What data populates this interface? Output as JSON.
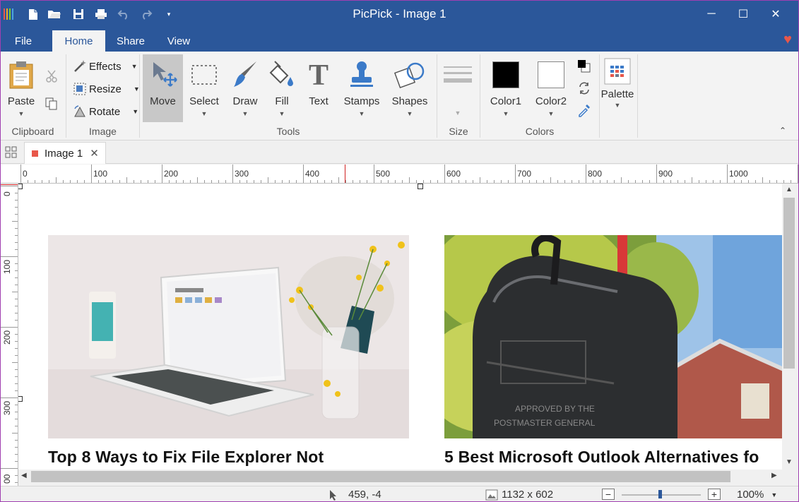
{
  "app": {
    "title": "PicPick - Image 1",
    "brand_color": "#2b579a",
    "accent_color": "#e8574a"
  },
  "quick_access": {
    "icons": [
      "app-logo-icon",
      "new-file-icon",
      "open-folder-icon",
      "save-icon",
      "print-icon",
      "undo-icon",
      "redo-icon",
      "customize-dropdown-icon"
    ]
  },
  "window_controls": {
    "minimize": "─",
    "maximize": "☐",
    "close": "✕"
  },
  "menu": {
    "tabs": [
      {
        "label": "File"
      },
      {
        "label": "Home"
      },
      {
        "label": "Share"
      },
      {
        "label": "View"
      }
    ],
    "active": "Home"
  },
  "ribbon": {
    "clipboard": {
      "label": "Clipboard",
      "paste": "Paste"
    },
    "image": {
      "label": "Image",
      "effects": "Effects",
      "resize": "Resize",
      "rotate": "Rotate"
    },
    "tools": {
      "label": "Tools",
      "move": "Move",
      "select": "Select",
      "draw": "Draw",
      "fill": "Fill",
      "text": "Text",
      "stamps": "Stamps",
      "shapes": "Shapes"
    },
    "size": {
      "label": "Size"
    },
    "colors": {
      "label": "Colors",
      "color1": "Color1",
      "color2": "Color2",
      "color1_value": "#000000",
      "color2_value": "#ffffff"
    },
    "palette": {
      "label": "Palette"
    }
  },
  "document_tabs": [
    {
      "label": "Image 1",
      "close": "✕"
    }
  ],
  "rulers": {
    "horizontal": [
      "0",
      "100",
      "200",
      "300",
      "400",
      "500",
      "600",
      "700",
      "800",
      "900",
      "1000"
    ],
    "vertical": [
      "0",
      "100",
      "200",
      "300",
      "00"
    ]
  },
  "canvas": {
    "cards": [
      {
        "title": "Top 8 Ways to Fix File Explorer Not"
      },
      {
        "title": "5 Best Microsoft Outlook Alternatives fo"
      }
    ]
  },
  "status": {
    "cursor_position": "459, -4",
    "image_size": "1132 x 602",
    "zoom": "100%",
    "zoom_minus": "−",
    "zoom_plus": "+"
  }
}
